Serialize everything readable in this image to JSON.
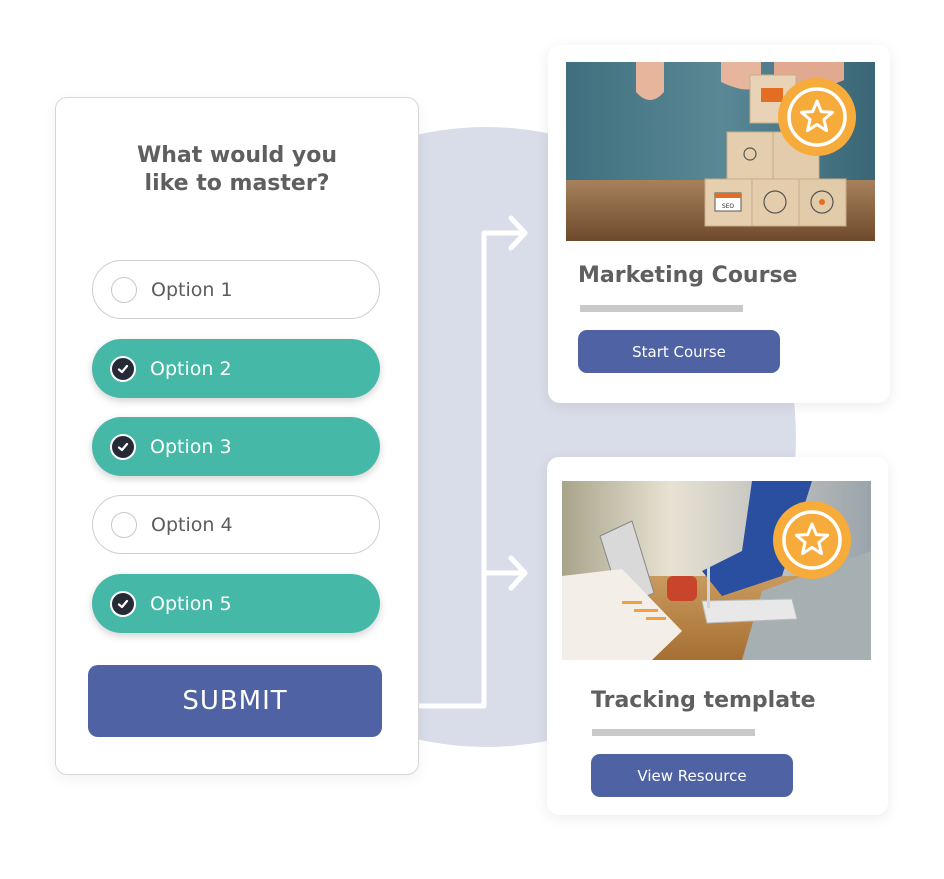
{
  "diagram": {
    "background_color": "#d9dde9",
    "connector_color": "#ffffff"
  },
  "form": {
    "question": "What would you\nlike to master?",
    "options": [
      {
        "label": "Option 1",
        "checked": false
      },
      {
        "label": "Option 2",
        "checked": true
      },
      {
        "label": "Option 3",
        "checked": true
      },
      {
        "label": "Option 4",
        "checked": false
      },
      {
        "label": "Option 5",
        "checked": true
      }
    ],
    "checked_color": "#46b8a8",
    "submit_label": "SUBMIT",
    "submit_color": "#4f62a3"
  },
  "results": [
    {
      "title": "Marketing Course",
      "image": "wooden-blocks-marketing-icons-photo",
      "badge_icon": "star-icon",
      "button_label": "Start Course"
    },
    {
      "title": "Tracking template",
      "image": "business-people-reviewing-charts-photo",
      "badge_icon": "star-icon",
      "button_label": "View Resource"
    }
  ],
  "badge_color": "#f7ab3a"
}
